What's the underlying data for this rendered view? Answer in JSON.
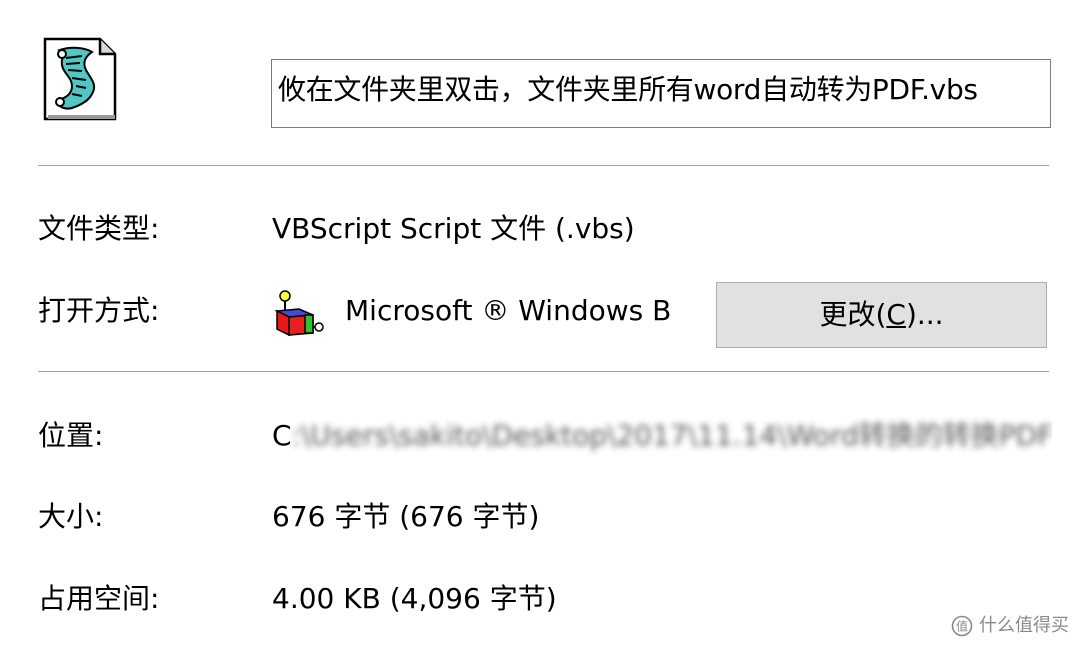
{
  "file": {
    "icon": "vbs-script-file-icon",
    "name": "攸在文件夹里双击，文件夹里所有word自动转为PDF.vbs"
  },
  "properties": {
    "type": {
      "label": "文件类型:",
      "value": "VBScript Script 文件 (.vbs)"
    },
    "opens_with": {
      "label": "打开方式:",
      "app_icon": "windows-script-host-icon",
      "app_name": "Microsoft ® Windows B",
      "change_button": {
        "before": "更改(",
        "mnemonic": "C",
        "after": ")..."
      }
    },
    "location": {
      "label": "位置:",
      "value_visible": "C",
      "value_blurred": ":\\Users\\sakito\\Desktop\\2017\\11.14\\Word转换的转换PDF"
    },
    "size": {
      "label": "大小:",
      "value": "676 字节 (676 字节)"
    },
    "size_on_disk": {
      "label": "占用空间:",
      "value": "4.00 KB (4,096 字节)"
    }
  },
  "watermark": {
    "icon": "smzdm-logo-icon",
    "text": "什么值得买"
  },
  "colors": {
    "separator": "#a0a0a0",
    "button_bg": "#e1e1e1",
    "button_border": "#adadad",
    "field_border": "#7a7a7a",
    "watermark": "#8a8a8a"
  }
}
